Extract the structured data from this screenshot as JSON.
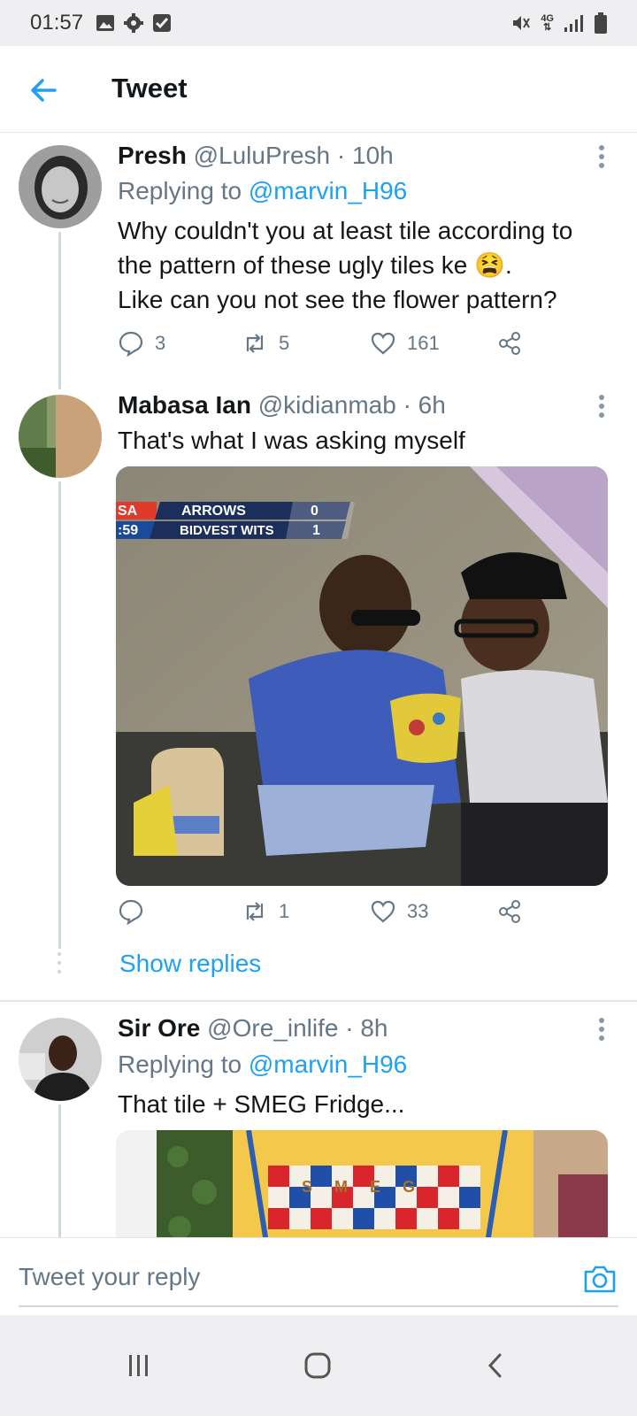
{
  "status_bar": {
    "time": "01:57",
    "left_icons": [
      "image-icon",
      "gear-icon",
      "check-box-icon"
    ],
    "network": "4G",
    "right_icons": [
      "mute-vibrate-icon",
      "network-icon",
      "signal-icon",
      "battery-icon"
    ]
  },
  "app_bar": {
    "back_icon": "arrow-left-icon",
    "title": "Tweet"
  },
  "tweets": [
    {
      "name": "Presh",
      "handle": "@LuluPresh",
      "time": "· 10h",
      "replying_label": "Replying to",
      "replying_to": "@marvin_H96",
      "text_lines": [
        "Why couldn't you at least tile according to",
        "the pattern of these ugly tiles ke 😫.",
        "Like can you not see the flower pattern?"
      ],
      "replies": "3",
      "retweets": "5",
      "likes": "161"
    },
    {
      "name": "Mabasa Ian",
      "handle": "@kidianmab",
      "time": "· 6h",
      "text_lines": [
        "That's what I was asking myself"
      ],
      "media_overlay": {
        "channel": "SA",
        "clock": ":59",
        "team1": "ARROWS",
        "score1": "0",
        "team2": "BIDVEST WITS",
        "score2": "1"
      },
      "replies": "",
      "retweets": "1",
      "likes": "33"
    },
    {
      "name": "Sir Ore",
      "handle": "@Ore_inlife",
      "time": "· 8h",
      "replying_label": "Replying to",
      "replying_to": "@marvin_H96",
      "text_lines": [
        "That tile + SMEG Fridge..."
      ],
      "media_text": "S M E G"
    }
  ],
  "show_replies": "Show replies",
  "reply_bar": {
    "placeholder": "Tweet your reply",
    "camera_icon": "camera-icon"
  },
  "nav_bar": {
    "icons": [
      "recent-apps-icon",
      "home-icon",
      "back-icon"
    ]
  },
  "colors": {
    "accent": "#1da1f2",
    "secondary_text": "#657786",
    "divider": "#e1e8ed"
  }
}
